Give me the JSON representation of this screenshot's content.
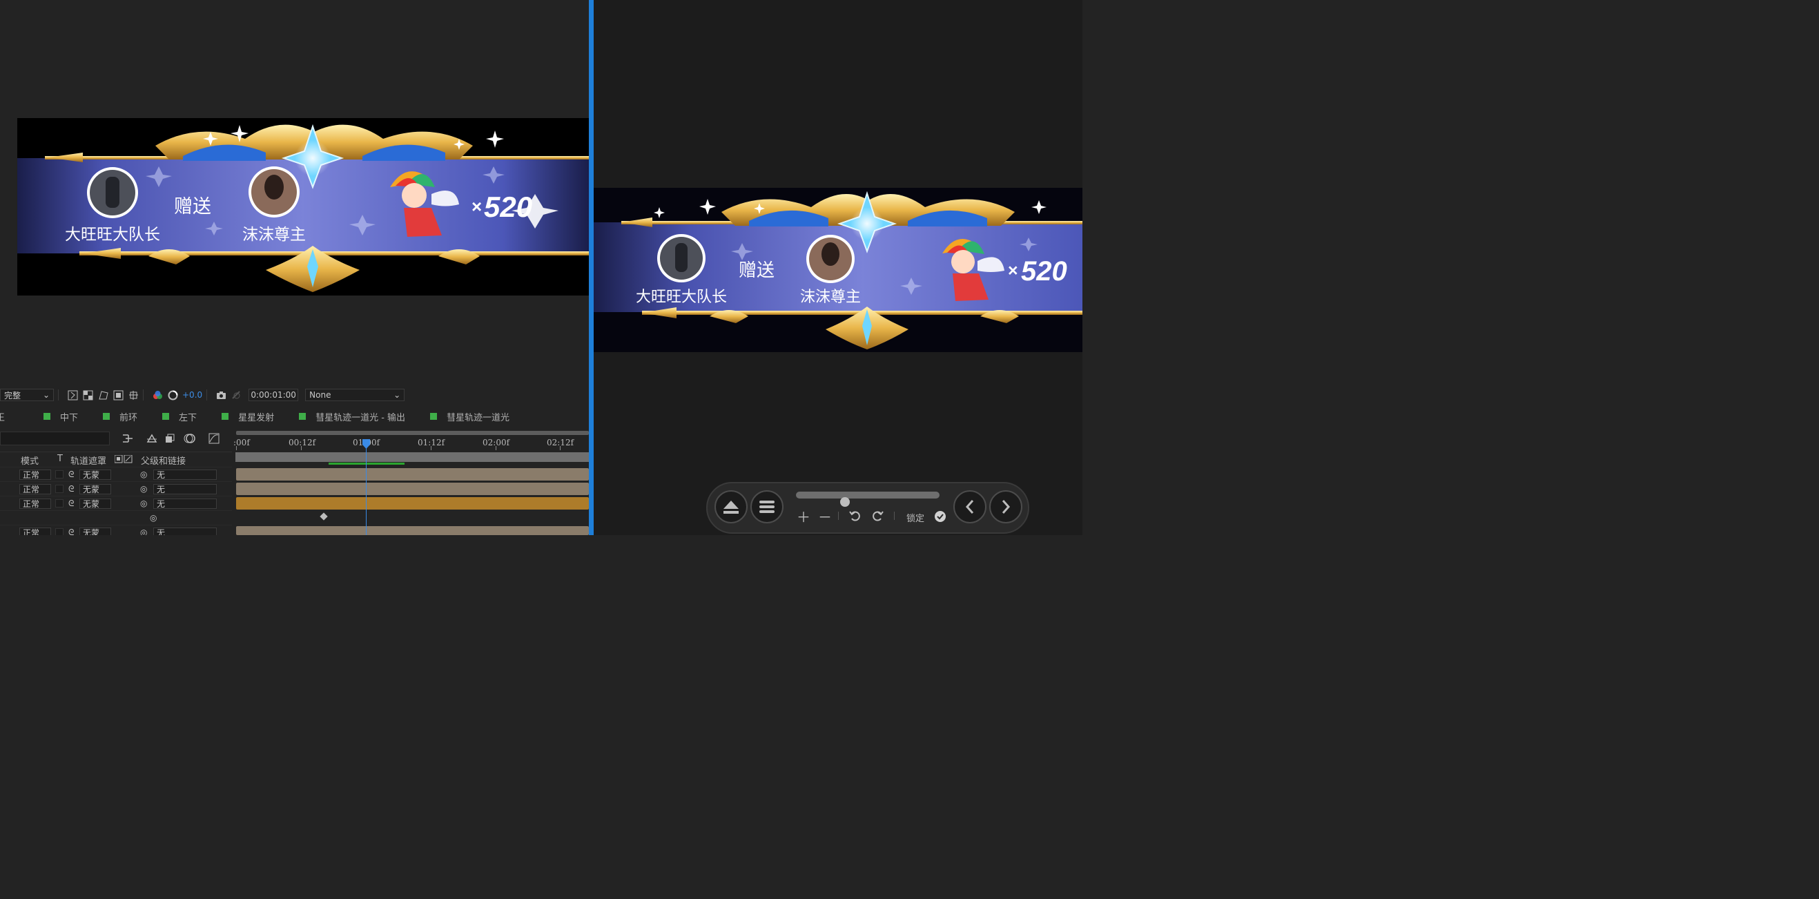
{
  "banner": {
    "sender": "大旺旺大队长",
    "action": "赠送",
    "receiver": "沫沫尊主",
    "gift_count": "520",
    "times_symbol": "×"
  },
  "toolbar": {
    "resolution": "完整",
    "exposure": "+0.0",
    "timecode": "0:00:01:00",
    "renderer": "None"
  },
  "tabs": [
    {
      "label": "王"
    },
    {
      "label": "中下"
    },
    {
      "label": "前环"
    },
    {
      "label": "左下"
    },
    {
      "label": "星星发射"
    },
    {
      "label": "彗星轨迹一道光 - 输出"
    },
    {
      "label": "彗星轨迹一道光"
    }
  ],
  "timeline": {
    "columns": {
      "mode": "模式",
      "t": "T",
      "track_matte": "轨道遮罩",
      "parent": "父级和链接"
    },
    "ruler_ticks": [
      ":00f",
      "00:12f",
      "01:00f",
      "01:12f",
      "02:00f",
      "02:12f"
    ],
    "layers": [
      {
        "mode": "正常",
        "matte": "无蒙",
        "parent": "无"
      },
      {
        "mode": "正常",
        "matte": "无蒙",
        "parent": "无"
      },
      {
        "mode": "正常",
        "matte": "无蒙",
        "parent": "无"
      },
      {
        "mode": "",
        "matte": "",
        "parent": ""
      },
      {
        "mode": "正常",
        "matte": "无蒙",
        "parent": "无"
      }
    ]
  },
  "preview_controls": {
    "lock_label": "锁定",
    "slider_value": 0.34
  },
  "colors": {
    "accent_blue": "#1e7fd9",
    "layer_bar": "#8a7c6a",
    "layer_bar_selected": "#ad7c2a",
    "label_green": "#3fae49"
  }
}
